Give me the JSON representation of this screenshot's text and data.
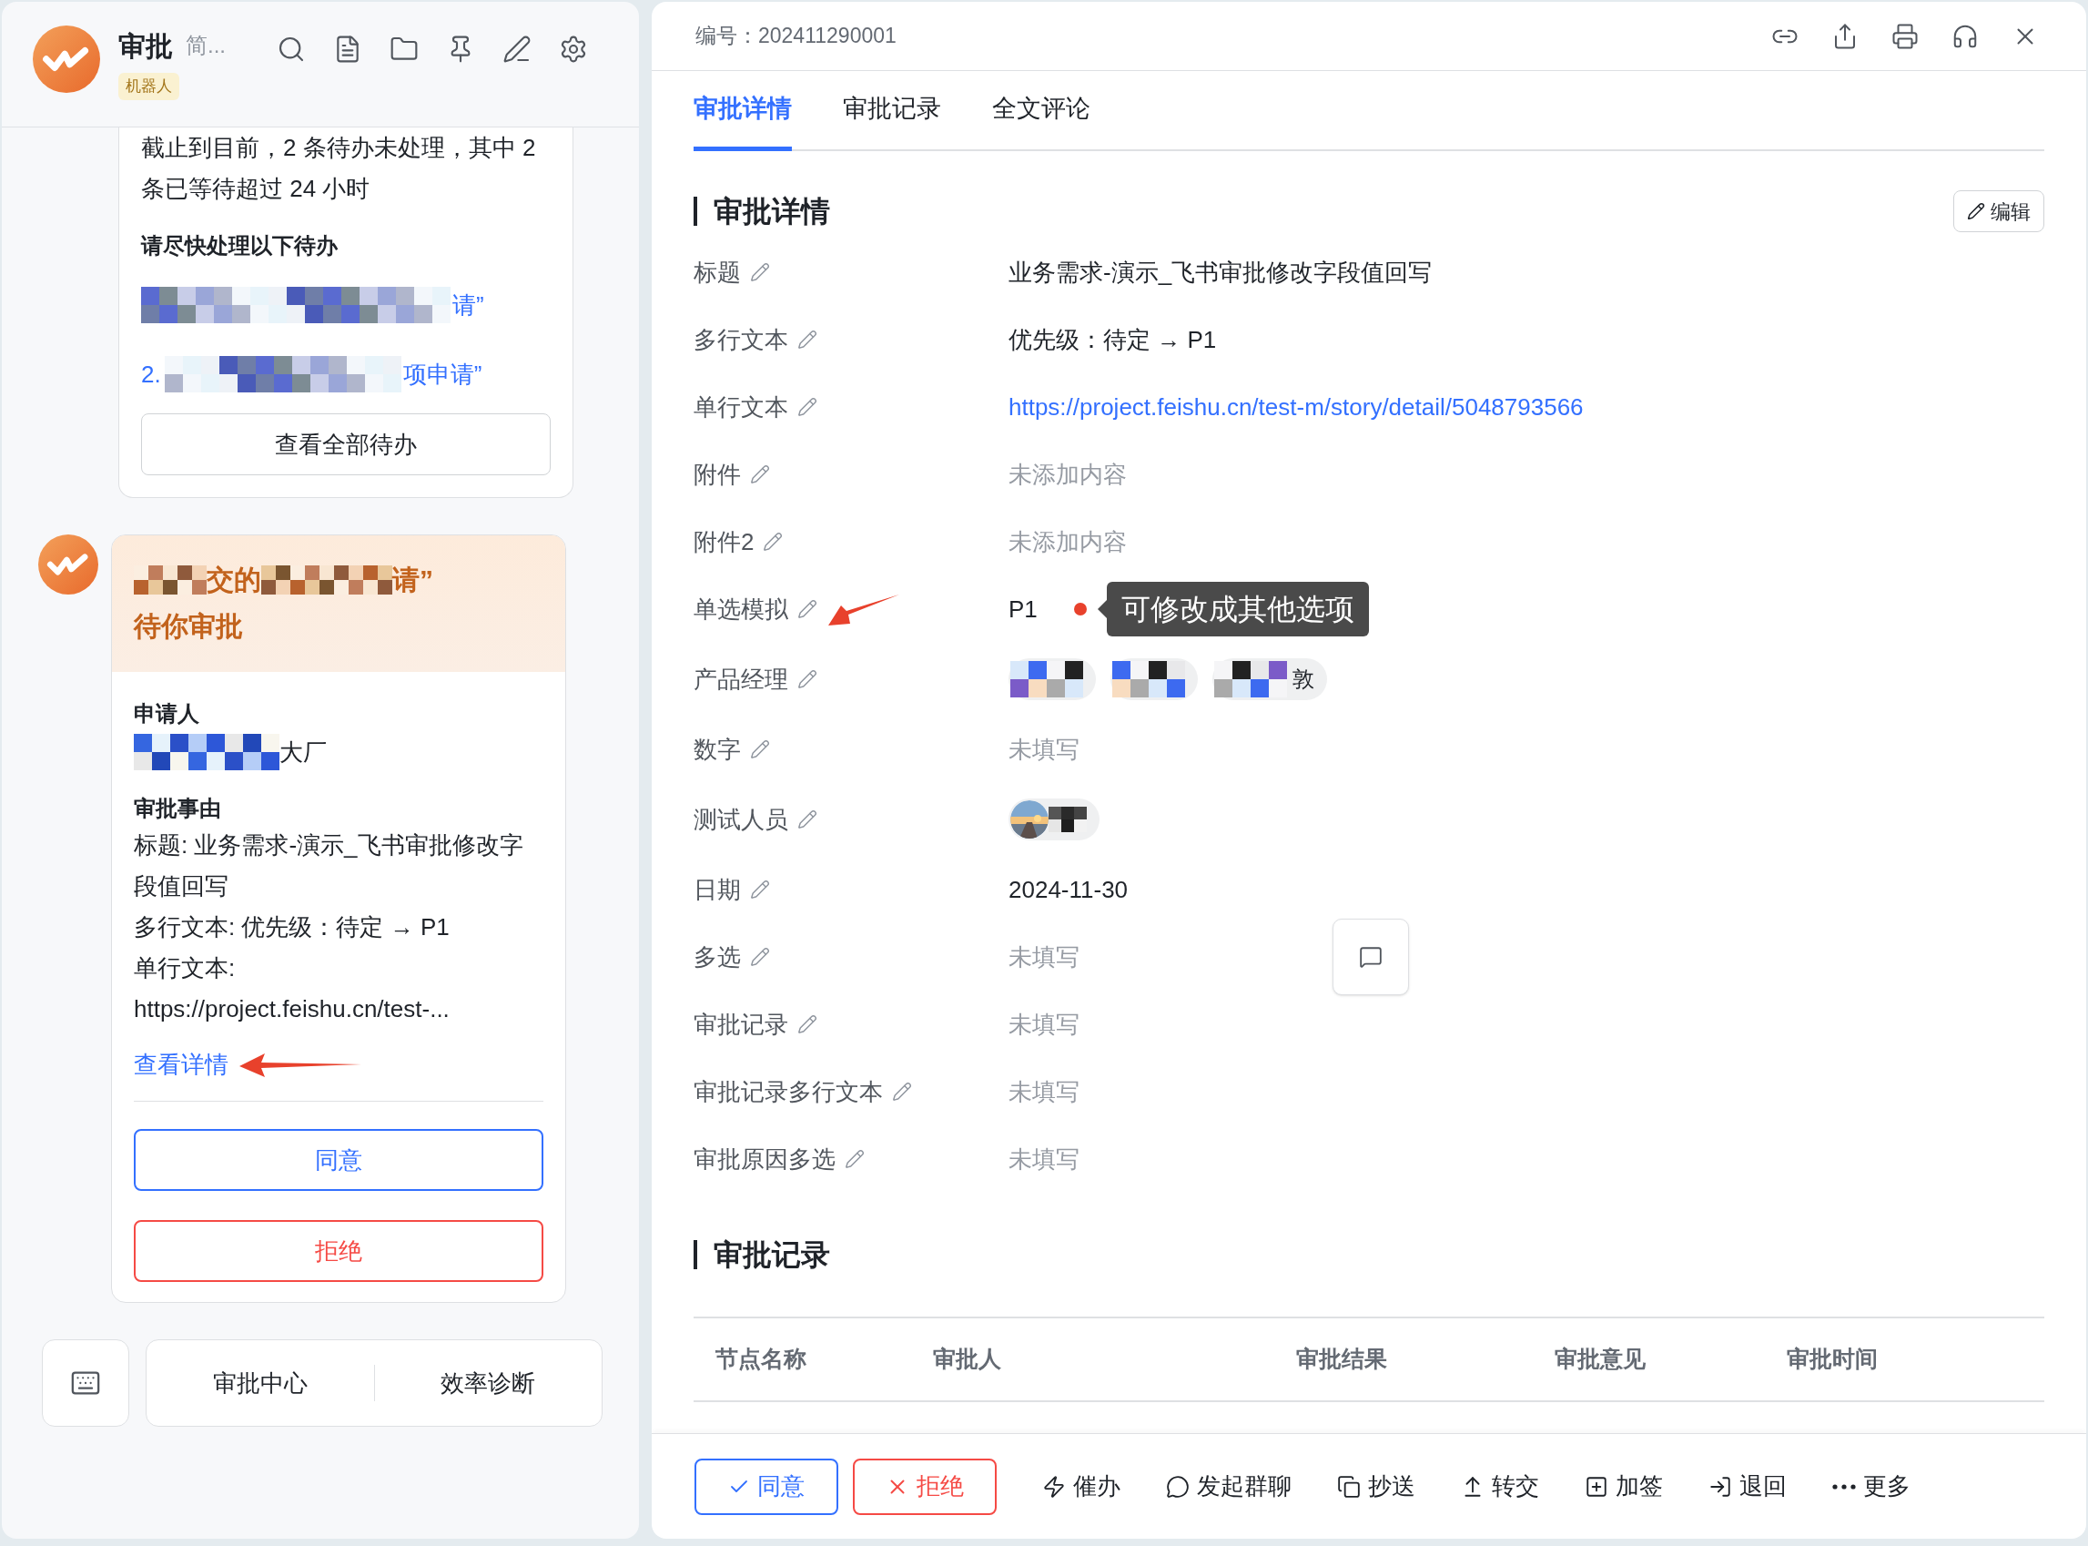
{
  "sidebar": {
    "app_name": "审批",
    "subtitle": "简...",
    "badge": "机器人",
    "summary_card": {
      "text": "截止到目前，2 条待办未处理，其中 2 条已等待超过 24 小时",
      "heading": "请尽快处理以下待办",
      "items": [
        {
          "text": "请”"
        },
        {
          "number": "2.",
          "text": "项申请”"
        }
      ],
      "button": "查看全部待办"
    },
    "approval_card": {
      "title_start": "交的",
      "title_end": "请”",
      "title_line2": "待你审批",
      "applicant_label": "申请人",
      "applicant": "大厂",
      "reason_label": "审批事由",
      "reason_lines": [
        "标题: 业务需求-演示_飞书审批修改字段值回写",
        "多行文本: 优先级：待定 → P1",
        "单行文本:",
        "https://project.feishu.cn/test-..."
      ],
      "link": "查看详情",
      "approve": "同意",
      "reject": "拒绝"
    },
    "bottom_buttons": [
      "审批中心",
      "效率诊断"
    ]
  },
  "detail": {
    "serial": "编号：202411290001",
    "tabs": [
      {
        "label": "审批详情",
        "selected": true
      },
      {
        "label": "审批记录",
        "selected": false
      },
      {
        "label": "全文评论",
        "selected": false
      }
    ],
    "section_title": "审批详情",
    "edit_button": "编辑",
    "fields": [
      {
        "label": "标题",
        "kind": "text",
        "value": "业务需求-演示_飞书审批修改字段值回写"
      },
      {
        "label": "多行文本",
        "kind": "text",
        "value": "优先级：待定 → P1"
      },
      {
        "label": "单行文本",
        "kind": "link",
        "value": "https://project.feishu.cn/test-m/story/detail/5048793566"
      },
      {
        "label": "附件",
        "kind": "empty",
        "value": "未添加内容"
      },
      {
        "label": "附件2",
        "kind": "empty",
        "value": "未添加内容"
      },
      {
        "label": "单选模拟",
        "kind": "option",
        "value": "P1",
        "tooltip": "可修改成其他选项"
      },
      {
        "label": "产品经理",
        "kind": "people",
        "people": [
          {
            "kind": "redacted"
          },
          {
            "kind": "redacted"
          },
          {
            "kind": "redacted",
            "name": "敦"
          }
        ]
      },
      {
        "label": "数字",
        "kind": "empty",
        "value": "未填写"
      },
      {
        "label": "测试人员",
        "kind": "people"
      },
      {
        "label": "日期",
        "kind": "text",
        "value": "2024-11-30"
      },
      {
        "label": "多选",
        "kind": "empty",
        "value": "未填写"
      },
      {
        "label": "审批记录",
        "kind": "empty",
        "value": "未填写"
      },
      {
        "label": "审批记录多行文本",
        "kind": "empty",
        "value": "未填写"
      },
      {
        "label": "审批原因多选",
        "kind": "empty",
        "value": "未填写"
      }
    ],
    "record_title": "审批记录",
    "table": {
      "columns": [
        "节点名称",
        "审批人",
        "审批结果",
        "审批意见",
        "审批时间"
      ]
    },
    "toolbar": {
      "approve": "同意",
      "reject": "拒绝",
      "actions": [
        {
          "kind": "urge",
          "label": "催办"
        },
        {
          "kind": "chat",
          "label": "发起群聊"
        },
        {
          "kind": "cc",
          "label": "抄送"
        },
        {
          "kind": "transfer",
          "label": "转交"
        },
        {
          "kind": "add",
          "label": "加签"
        },
        {
          "kind": "return",
          "label": "退回"
        },
        {
          "kind": "more",
          "label": "更多"
        }
      ]
    }
  }
}
